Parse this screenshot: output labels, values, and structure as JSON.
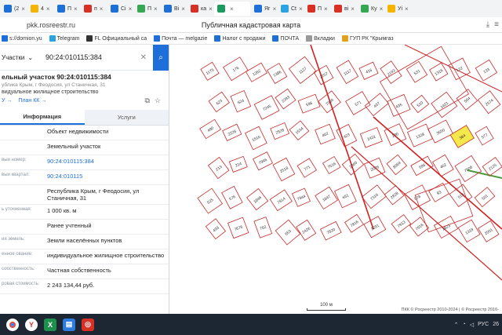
{
  "browser": {
    "tabs": [
      {
        "label": "(2",
        "color": "#1e6fd9"
      },
      {
        "label": "4",
        "color": "#f4b400"
      },
      {
        "label": "П",
        "color": "#1e6fd9"
      },
      {
        "label": "п",
        "color": "#d93025"
      },
      {
        "label": "Сi",
        "color": "#1e6fd9"
      },
      {
        "label": "П",
        "color": "#34a853"
      },
      {
        "label": "Ві",
        "color": "#1e6fd9"
      },
      {
        "label": "ка",
        "color": "#d93025"
      },
      {
        "label": "",
        "color": "#1a9b5c",
        "active": true
      },
      {
        "label": "Яг",
        "color": "#1e6fd9"
      },
      {
        "label": "Ct",
        "color": "#2aa3e0"
      },
      {
        "label": "П",
        "color": "#d93025"
      },
      {
        "label": "ві",
        "color": "#d93025"
      },
      {
        "label": "Ку",
        "color": "#34a853"
      },
      {
        "label": "Уі",
        "color": "#f4b400"
      }
    ],
    "url": "pkk.rosreestr.ru",
    "page_title": "Публичная кадастровая карта",
    "bookmarks": [
      {
        "label": "s://domion.yu",
        "color": "#1e6fd9"
      },
      {
        "label": "Telegram",
        "color": "#2aa3e0"
      },
      {
        "label": "FL Официальный са",
        "color": "#333333"
      },
      {
        "label": "Почта — melgazie",
        "color": "#1e6fd9"
      },
      {
        "label": "Налог с продажи",
        "color": "#1e6fd9"
      },
      {
        "label": "ПОЧТА",
        "color": "#1e6fd9"
      },
      {
        "label": "Вкладки",
        "color": "#999999"
      },
      {
        "label": "ГУП РК \"Крымгаз",
        "color": "#e0a020"
      }
    ]
  },
  "panel": {
    "search_scope": "Участки",
    "search_value": "90:24:010115:384",
    "title": "ельный участок 90:24:010115:384",
    "address": "ублика Крым, г Феодосия, ул Станичная, 31",
    "usage": "видуальное жилищное строительство",
    "links": [
      "У →",
      "План КК →"
    ],
    "tab_info": "Информация",
    "tab_services": "Услуги",
    "rows": [
      {
        "label": "",
        "value": "Объект недвижимости",
        "link": false
      },
      {
        "label": "",
        "value": "Земельный участок",
        "link": false
      },
      {
        "label": "вый номер:",
        "value": "90:24:010115:384",
        "link": true
      },
      {
        "label": "вый квартал:",
        "value": "90:24:010115",
        "link": true
      },
      {
        "label": "",
        "value": "Республика Крым, г Феодосия, ул Станичная, 31",
        "link": false
      },
      {
        "label": "ь уточненная:",
        "value": "1 000 кв. м",
        "link": false
      },
      {
        "label": "",
        "value": "Ранее учтенный",
        "link": false
      },
      {
        "label": "ия земель:",
        "value": "Земли населённых пунктов",
        "link": false
      },
      {
        "label": "енное ование:",
        "value": "индивидуальное жилищное строительство",
        "link": false
      },
      {
        "label": "собственность:",
        "value": "Частная собственность",
        "link": false
      },
      {
        "label": "ровая стоимость:",
        "value": "2 243 134,44 руб.",
        "link": false
      }
    ]
  },
  "map": {
    "scale_label": "100 м",
    "attribution": "ПКК © Росреестр 2010-2024 | © Росреестр 2016-",
    "selected_parcel": "384",
    "parcel_labels": [
      "1175",
      "176",
      "1262",
      "1386",
      "1127",
      "2257",
      "1117",
      "416",
      "2193",
      "531",
      "1316",
      "132",
      "133",
      "623",
      "624",
      "7245",
      "2393",
      "596",
      "7960",
      "571",
      "407",
      "435",
      "510",
      "1421",
      "504",
      "2574",
      "480",
      "2226",
      "1516",
      "2528",
      "1534",
      "402",
      "423",
      "1431",
      "280",
      "1328",
      "3550",
      "384",
      "577",
      "213",
      "214",
      "7946",
      "2518",
      "771",
      "7516",
      "2360",
      "2026",
      "8064",
      "596",
      "462",
      "7506",
      "2125",
      "525",
      "576",
      "1846",
      "7914",
      "7944",
      "1847",
      "651",
      "7316",
      "2828",
      "978",
      "93",
      "516",
      "501",
      "493",
      "7676",
      "762",
      "653",
      "2426",
      "7820",
      "7816",
      "3291",
      "7913",
      "7916",
      "1823",
      "1319",
      "2001"
    ]
  },
  "taskbar": {
    "lang": "РУС",
    "time": "26"
  }
}
